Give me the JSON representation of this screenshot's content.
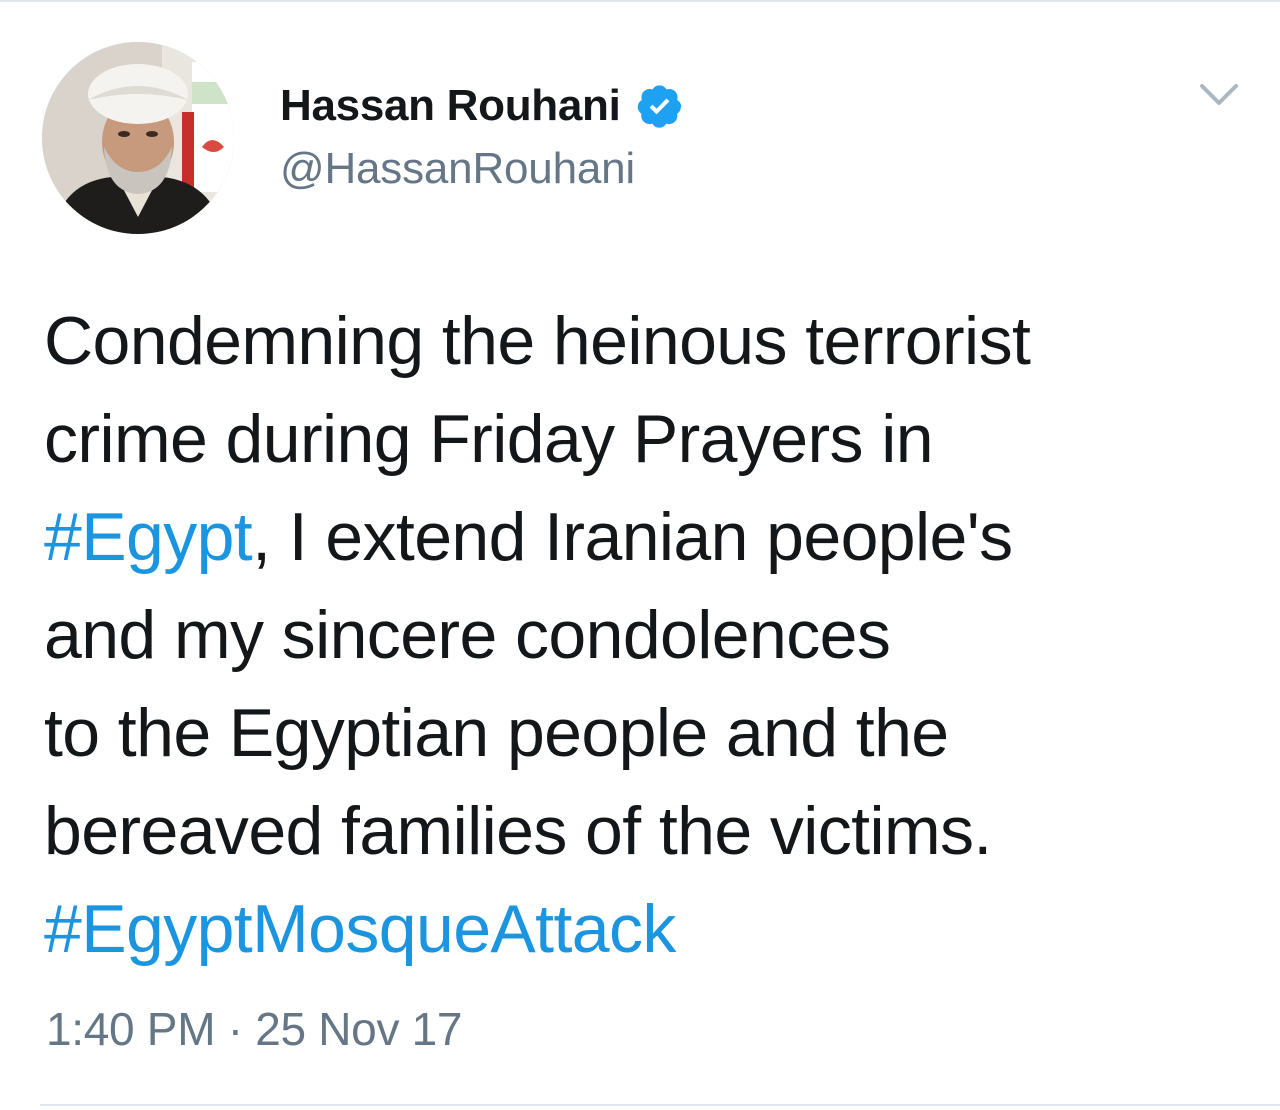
{
  "author": {
    "display_name": "Hassan Rouhani",
    "handle": "@HassanRouhani",
    "verified": true,
    "avatar_icon": "profile-photo"
  },
  "menu": {
    "caret_icon": "chevron-down-icon"
  },
  "tweet": {
    "lines": [
      [
        {
          "text": "Condemning the heinous terrorist",
          "type": "text"
        }
      ],
      [
        {
          "text": "crime during Friday Prayers in",
          "type": "text"
        }
      ],
      [
        {
          "text": "#Egypt",
          "type": "hashtag"
        },
        {
          "text": ", I extend Iranian people's",
          "type": "text"
        }
      ],
      [
        {
          "text": "and my sincere condolences",
          "type": "text"
        }
      ],
      [
        {
          "text": "to the Egyptian people and the",
          "type": "text"
        }
      ],
      [
        {
          "text": "bereaved families of the victims.",
          "type": "text"
        }
      ],
      [
        {
          "text": "#EgyptMosqueAttack",
          "type": "hashtag"
        }
      ]
    ]
  },
  "timestamp": "1:40 PM · 25 Nov 17",
  "colors": {
    "text": "#14171a",
    "secondary": "#657786",
    "link": "#1b95e0",
    "verified": "#1da1f2",
    "divider": "#e1e8ed"
  }
}
